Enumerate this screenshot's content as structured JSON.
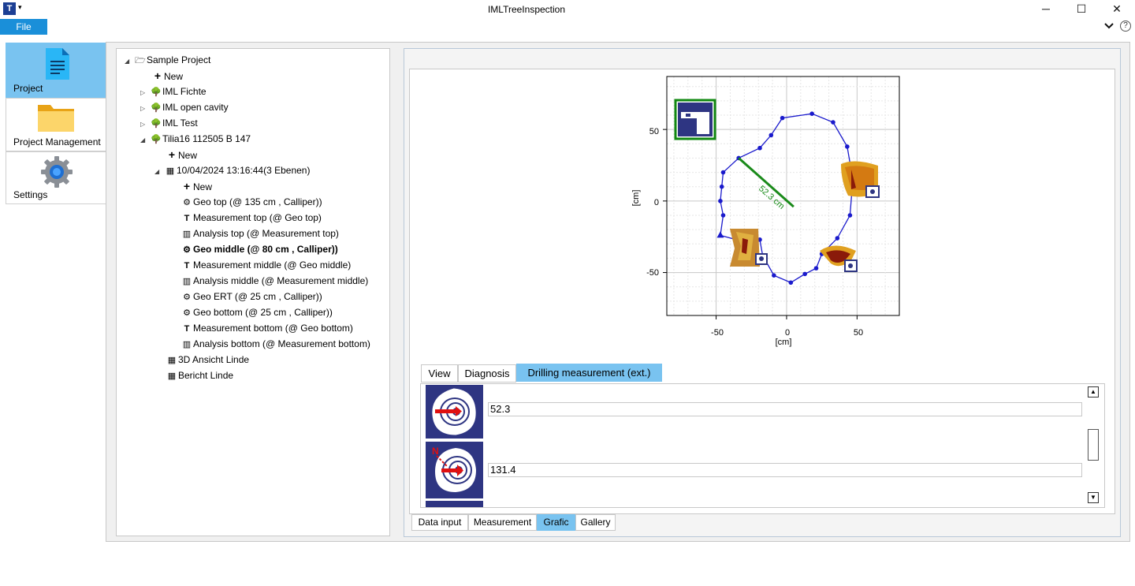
{
  "window": {
    "title": "IMLTreeInspection",
    "minimize": "─",
    "maximize": "☐",
    "close": "✕",
    "app_icon_letter": "T"
  },
  "menu": {
    "file": "File"
  },
  "nav": [
    {
      "label": "Project",
      "icon": "document-icon"
    },
    {
      "label": "Project Management",
      "icon": "folder-icon"
    },
    {
      "label": "Settings",
      "icon": "gear-icon"
    }
  ],
  "tree": {
    "root": "Sample Project",
    "new_1": "New",
    "fichte": "IML Fichte",
    "cavity": "IML open cavity",
    "test": "IML Test",
    "tilia": "Tilia16 112505 B 147",
    "new_2": "New",
    "session": "10/04/2024 13:16:44(3 Ebenen)",
    "new_3": "New",
    "items": [
      {
        "label": "Geo top (@ 135 cm , Calliper))",
        "icon": "geo-icon"
      },
      {
        "label": "Measurement top (@ Geo top)",
        "icon": "measurement-icon"
      },
      {
        "label": "Analysis top (@ Measurement top)",
        "icon": "analysis-icon"
      },
      {
        "label": "Geo middle (@ 80 cm , Calliper))",
        "icon": "geo-icon"
      },
      {
        "label": "Measurement middle (@ Geo middle)",
        "icon": "measurement-icon"
      },
      {
        "label": "Analysis middle (@ Measurement middle)",
        "icon": "analysis-icon"
      },
      {
        "label": "Geo ERT (@ 25 cm , Calliper))",
        "icon": "geo-icon"
      },
      {
        "label": "Geo bottom (@ 25 cm , Calliper))",
        "icon": "geo-icon"
      },
      {
        "label": "Measurement bottom (@ Geo bottom)",
        "icon": "measurement-icon"
      },
      {
        "label": "Analysis bottom (@ Measurement bottom)",
        "icon": "analysis-icon"
      }
    ],
    "view3d": "3D Ansicht Linde",
    "report": "Bericht Linde"
  },
  "chart": {
    "x_ticks": [
      "-50",
      "0",
      "50"
    ],
    "y_ticks": [
      "50",
      "0",
      "-50"
    ],
    "xlabel": "[cm]",
    "ylabel": "[cm]",
    "measure_label": "52.3 cm"
  },
  "chart_data": {
    "type": "line",
    "xlabel": "[cm]",
    "ylabel": "[cm]",
    "xlim": [
      -85,
      80
    ],
    "ylim": [
      -80,
      87
    ],
    "grid": true,
    "series": [
      {
        "color": "#1a1acc",
        "points": [
          [
            -47,
            -24
          ],
          [
            -45,
            -10
          ],
          [
            -47,
            0
          ],
          [
            -46,
            10
          ],
          [
            -45,
            20
          ],
          [
            -34,
            30
          ],
          [
            -19,
            37
          ],
          [
            -11,
            46
          ],
          [
            -3,
            58
          ],
          [
            18,
            61
          ],
          [
            33,
            55
          ],
          [
            43,
            38
          ],
          [
            47,
            15
          ],
          [
            45,
            -10
          ],
          [
            36,
            -26
          ],
          [
            25,
            -37
          ],
          [
            21,
            -47
          ],
          [
            13,
            -51
          ],
          [
            3,
            -57
          ],
          [
            -9,
            -52
          ],
          [
            -17,
            -38
          ],
          [
            -19,
            -27
          ],
          [
            -25,
            -25
          ],
          [
            -32,
            -28
          ],
          [
            -47,
            -24
          ]
        ]
      },
      {
        "color": "#1a8a1a",
        "points": [
          [
            -34,
            30
          ],
          [
            5,
            -4
          ]
        ]
      }
    ]
  },
  "tabs": [
    "View",
    "Diagnosis",
    "Drilling measurement (ext.)"
  ],
  "drill": {
    "value_1": "52.3",
    "value_2": "131.4"
  },
  "bottom_tabs": [
    "Data input",
    "Measurement",
    "Grafic",
    "Gallery"
  ],
  "colors": {
    "accent": "#79c3f0",
    "menu": "#1a8fd9",
    "thumb_bg": "#2e3582"
  }
}
